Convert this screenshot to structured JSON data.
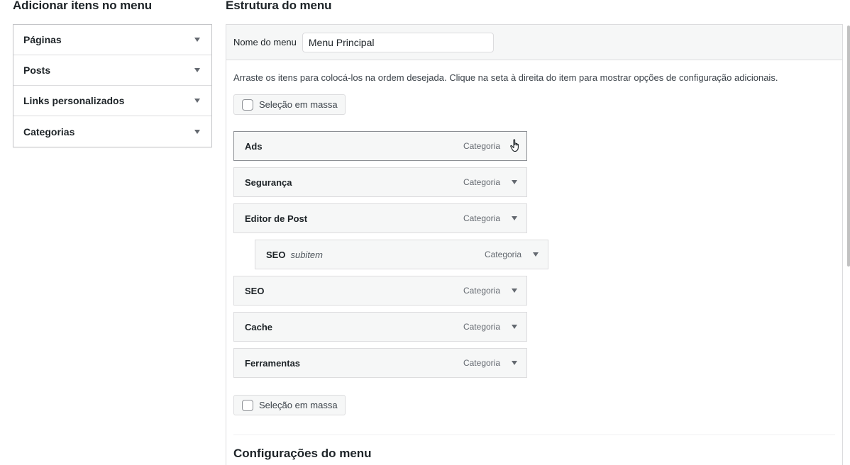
{
  "left": {
    "title": "Adicionar itens no menu",
    "sections": [
      {
        "label": "Páginas"
      },
      {
        "label": "Posts"
      },
      {
        "label": "Links personalizados"
      },
      {
        "label": "Categorias"
      }
    ]
  },
  "right": {
    "title": "Estrutura do menu",
    "menu_name_label": "Nome do menu",
    "menu_name_value": "Menu Principal",
    "instructions": "Arraste os itens para colocá-los na ordem desejada. Clique na seta à direita do item para mostrar opções de configuração adicionais.",
    "bulk_select_label": "Seleção em massa",
    "items": [
      {
        "title": "Ads",
        "type": "Categoria",
        "sub": ""
      },
      {
        "title": "Segurança",
        "type": "Categoria",
        "sub": ""
      },
      {
        "title": "Editor de Post",
        "type": "Categoria",
        "sub": ""
      },
      {
        "title": "SEO",
        "type": "Categoria",
        "sub": "subitem"
      },
      {
        "title": "SEO",
        "type": "Categoria",
        "sub": ""
      },
      {
        "title": "Cache",
        "type": "Categoria",
        "sub": ""
      },
      {
        "title": "Ferramentas",
        "type": "Categoria",
        "sub": ""
      }
    ],
    "settings_title": "Configurações do menu"
  },
  "icons": {
    "dropdown": "triangle-down-icon",
    "cursor": "hand-pointer-icon"
  },
  "colors": {
    "panel_bg": "#f6f7f7",
    "border": "#dcdcde",
    "text": "#1d2327"
  }
}
